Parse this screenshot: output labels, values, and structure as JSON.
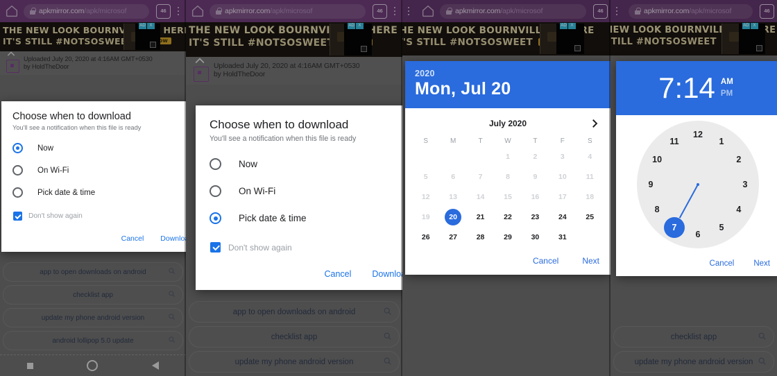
{
  "browser": {
    "url_domain": "apkmirror.com",
    "url_path": "/apk/microsof",
    "tab_count": "46",
    "home_icon": "home-icon",
    "lock_icon": "lock-icon",
    "menu_icon": "overflow-menu-icon"
  },
  "ad": {
    "line1": "THE NEW LOOK BOURNVILLE IS HERE",
    "line2": "IT'S STILL #NOTSOSWEET",
    "cta": "BUY NOW",
    "badge_left": "AD",
    "badge_right": "X"
  },
  "upload": {
    "line1": "Uploaded July 20, 2020 at 4:16AM GMT+0530",
    "line2": "by HoldTheDoor"
  },
  "dialog": {
    "title": "Choose when to download",
    "subtitle": "You'll see a notification when this file is ready",
    "options": [
      "Now",
      "On Wi-Fi",
      "Pick date & time"
    ],
    "checkbox_label": "Don't show again",
    "cancel": "Cancel",
    "confirm": "Download",
    "panel1_selected": "Now",
    "panel2_selected": "Pick date & time"
  },
  "datepicker": {
    "year": "2020",
    "headline": "Mon, Jul 20",
    "month_label": "July 2020",
    "next_icon": "chevron-right-icon",
    "weekdays": [
      "S",
      "M",
      "T",
      "W",
      "T",
      "F",
      "S"
    ],
    "lead_blanks": 3,
    "days": [
      1,
      2,
      3,
      4,
      5,
      6,
      7,
      8,
      9,
      10,
      11,
      12,
      13,
      14,
      15,
      16,
      17,
      18,
      19,
      20,
      21,
      22,
      23,
      24,
      25,
      26,
      27,
      28,
      29,
      30,
      31
    ],
    "disabled_through": 19,
    "selected_day": 20,
    "cancel": "Cancel",
    "next": "Next"
  },
  "timepicker": {
    "hour": "7",
    "separator": ":",
    "minute": "14",
    "meridiem_am": "AM",
    "meridiem_pm": "PM",
    "meridiem_selected": "AM",
    "hours": [
      12,
      1,
      2,
      3,
      4,
      5,
      6,
      7,
      8,
      9,
      10,
      11
    ],
    "selected_hour": 7,
    "cancel": "Cancel",
    "next": "Next"
  },
  "suggestions": [
    "app to open downloads on android",
    "checklist app",
    "update my phone android version",
    "android lollipop 5.0 update"
  ],
  "navbar": {
    "recents": "recents-square-icon",
    "home": "home-circle-icon",
    "back": "back-triangle-icon"
  },
  "colors": {
    "chrome_purple": "#6a3b73",
    "accent_blue": "#2a6bdd",
    "link_blue": "#1a73e8",
    "scrim_gray": "#6b6b6b"
  }
}
